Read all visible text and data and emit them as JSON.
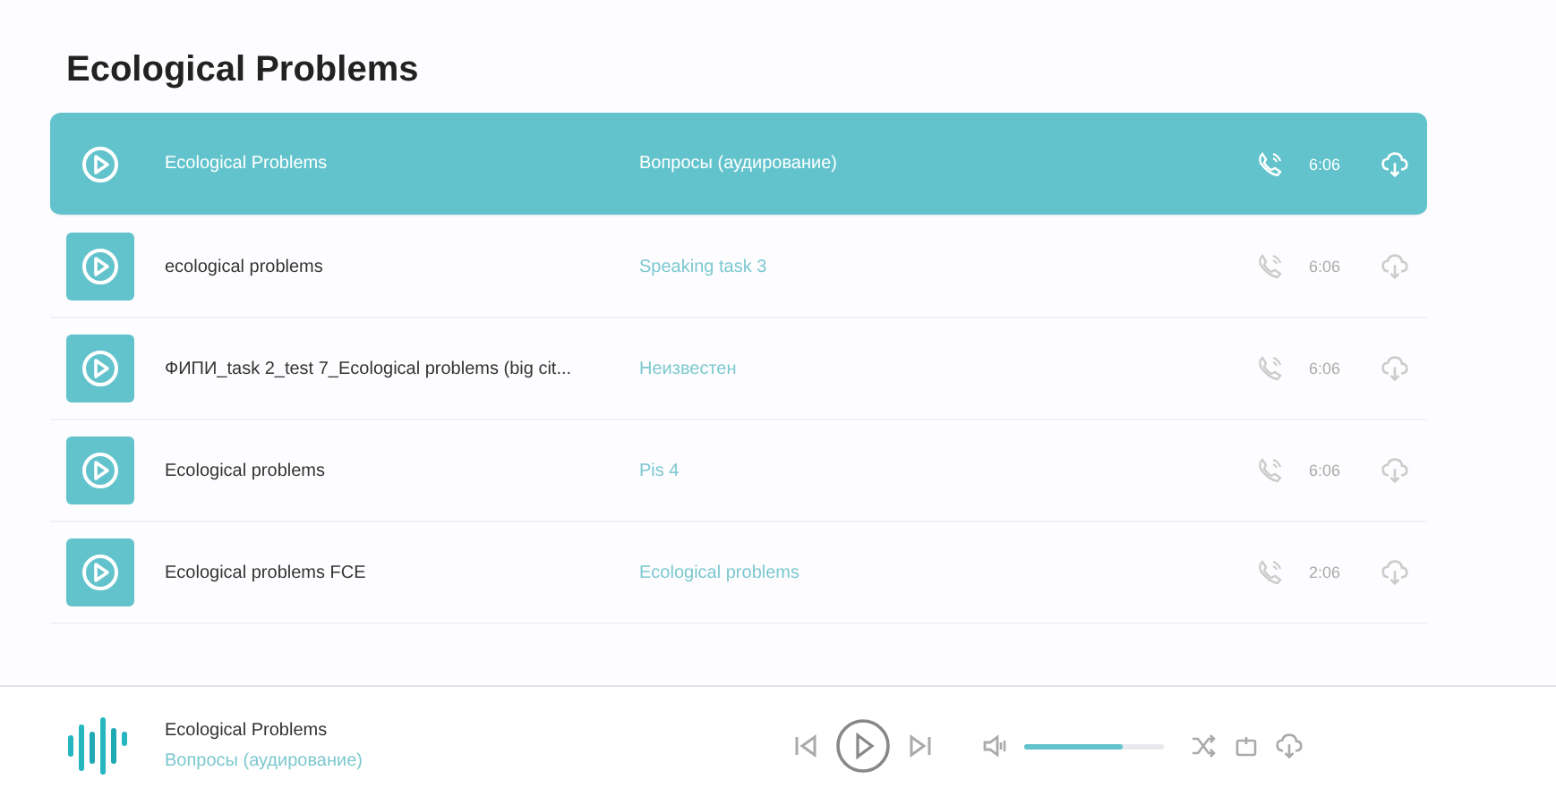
{
  "heading": "Ecological Problems",
  "tracks": [
    {
      "title": "Ecological Problems",
      "category": "Вопросы (аудирование)",
      "duration": "6:06",
      "selected": true
    },
    {
      "title": "ecological problems",
      "category": "Speaking task 3",
      "duration": "6:06",
      "selected": false
    },
    {
      "title": "ФИПИ_task 2_test 7_Ecological problems (big cit...",
      "category": "Неизвестен",
      "duration": "6:06",
      "selected": false
    },
    {
      "title": "Ecological problems",
      "category": "Pis 4",
      "duration": "6:06",
      "selected": false
    },
    {
      "title": "Ecological problems FCE",
      "category": "Ecological problems",
      "duration": "2:06",
      "selected": false
    }
  ],
  "player": {
    "title": "Ecological Problems",
    "subtitle": "Вопросы (аудирование)",
    "volume": {
      "level": 0.7
    }
  }
}
